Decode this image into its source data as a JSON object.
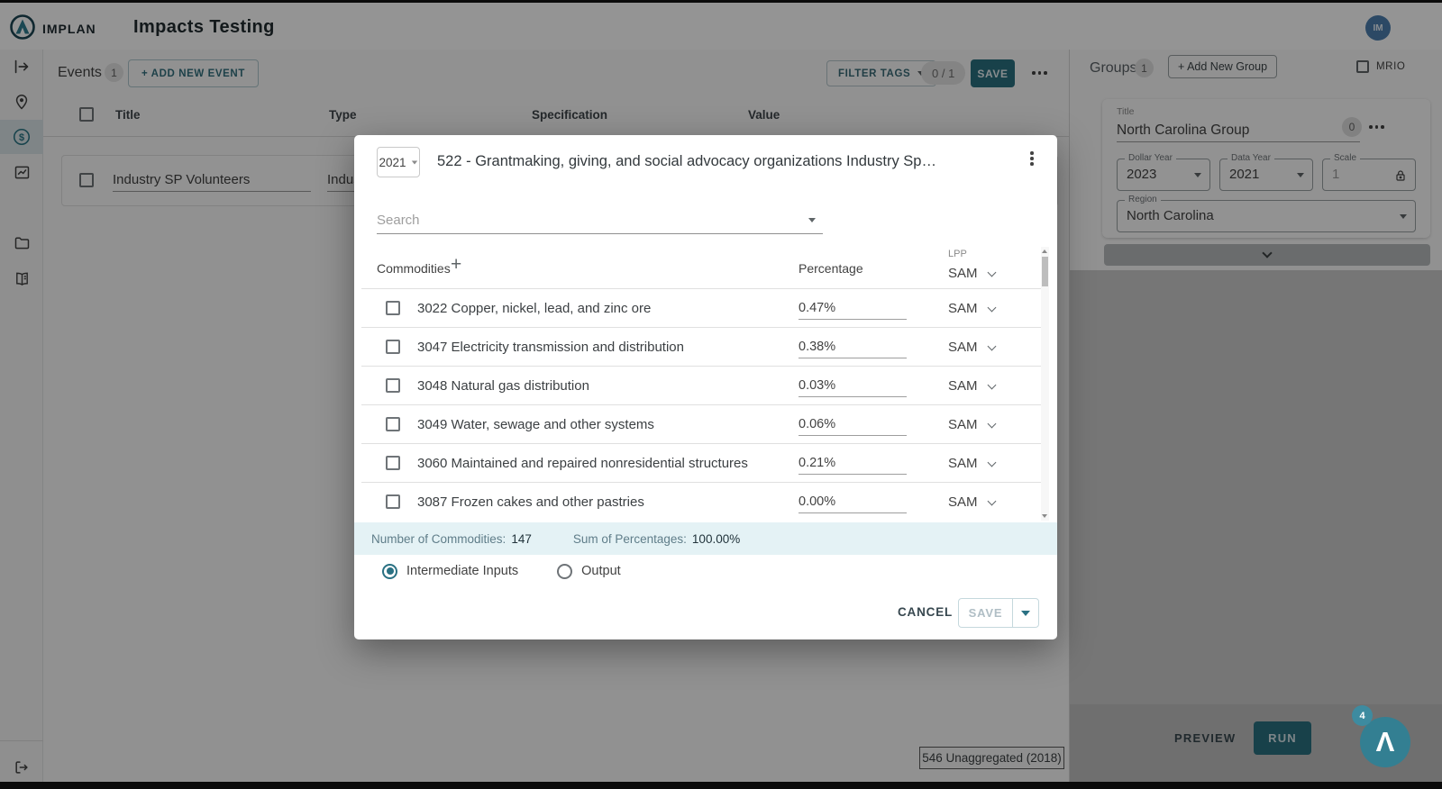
{
  "header": {
    "brand": "IMPLAN",
    "title": "Impacts Testing",
    "avatar": "IM"
  },
  "toolbar": {
    "events_label": "Events",
    "events_count": "1",
    "add_event": "+ ADD NEW EVENT",
    "filter_tags": "FILTER TAGS",
    "tag_counter": "0 / 1",
    "save": "SAVE"
  },
  "events_table": {
    "columns": [
      "Title",
      "Type",
      "Specification",
      "Value"
    ],
    "row": {
      "title": "Industry SP Volunteers",
      "type_partial": "Indus"
    }
  },
  "groups_panel": {
    "label": "Groups",
    "count": "1",
    "add_group": "+ Add New Group",
    "mrio": "MRIO",
    "card": {
      "title_label": "Title",
      "title": "North Carolina Group",
      "badge": "0",
      "dollar_year_label": "Dollar Year",
      "dollar_year": "2023",
      "data_year_label": "Data Year",
      "data_year": "2021",
      "scale_label": "Scale",
      "scale": "1",
      "region_label": "Region",
      "region": "North Carolina"
    },
    "footer": {
      "preview": "PREVIEW",
      "run": "RUN"
    },
    "fab_count": "4",
    "fab_glyph": "Λ"
  },
  "status_box": "546 Unaggregated (2018)",
  "modal": {
    "year": "2021",
    "title": "522 - Grantmaking, giving, and social advocacy organizations Industry Sp…",
    "search_placeholder": "Search",
    "table": {
      "commodities": "Commodities",
      "add": "+",
      "percentage": "Percentage",
      "lpp": "LPP",
      "lpp_value": "SAM"
    },
    "rows": [
      {
        "label": "3022 Copper, nickel, lead, and zinc ore",
        "percentage": "0.47%",
        "lpp": "SAM"
      },
      {
        "label": "3047 Electricity transmission and distribution",
        "percentage": "0.38%",
        "lpp": "SAM"
      },
      {
        "label": "3048 Natural gas distribution",
        "percentage": "0.03%",
        "lpp": "SAM"
      },
      {
        "label": "3049 Water, sewage and other systems",
        "percentage": "0.06%",
        "lpp": "SAM"
      },
      {
        "label": "3060 Maintained and repaired nonresidential structures",
        "percentage": "0.21%",
        "lpp": "SAM"
      },
      {
        "label": "3087 Frozen cakes and other pastries",
        "percentage": "0.00%",
        "lpp": "SAM"
      }
    ],
    "summary": {
      "count_label": "Number of Commodities:",
      "count": "147",
      "sum_label": "Sum of Percentages:",
      "sum": "100.00%"
    },
    "radios": {
      "intermediate": "Intermediate Inputs",
      "output": "Output",
      "selected": "intermediate"
    },
    "actions": {
      "cancel": "CANCEL",
      "save": "SAVE"
    }
  },
  "colors": {
    "accent": "#2a7080",
    "accent_light": "#e4f2f5",
    "fab": "#337f92",
    "avatar": "#4d7fae"
  }
}
